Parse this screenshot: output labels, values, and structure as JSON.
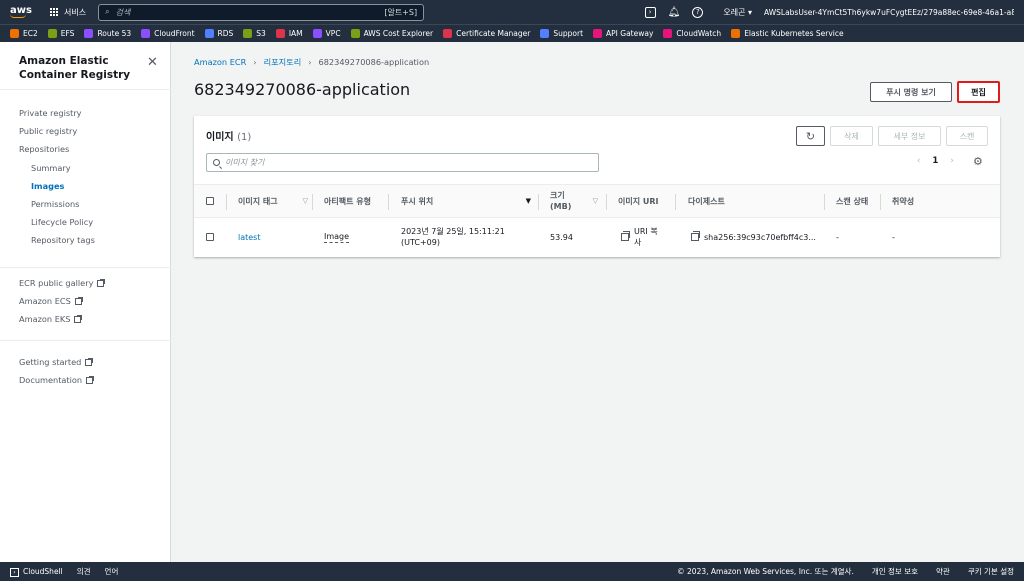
{
  "topbar": {
    "logo": "aws",
    "services_label": "서비스",
    "search_placeholder": "검색",
    "search_shortcut": "[알트+S]",
    "region": "오레곤 ▾",
    "account": "AWSLabsUser-4YmCt5Th6ykw7uFCygtEEz/279a88ec-69e8-46a1-a8f8-fc..."
  },
  "favorites": [
    {
      "label": "EC2",
      "color": "#ed7100"
    },
    {
      "label": "EFS",
      "color": "#7aa116"
    },
    {
      "label": "Route 53",
      "color": "#8c4fff"
    },
    {
      "label": "CloudFront",
      "color": "#8c4fff"
    },
    {
      "label": "RDS",
      "color": "#527fff"
    },
    {
      "label": "S3",
      "color": "#7aa116"
    },
    {
      "label": "IAM",
      "color": "#dd344c"
    },
    {
      "label": "VPC",
      "color": "#8c4fff"
    },
    {
      "label": "AWS Cost Explorer",
      "color": "#7aa116"
    },
    {
      "label": "Certificate Manager",
      "color": "#dd344c"
    },
    {
      "label": "Support",
      "color": "#527fff"
    },
    {
      "label": "API Gateway",
      "color": "#e7157b"
    },
    {
      "label": "CloudWatch",
      "color": "#e7157b"
    },
    {
      "label": "Elastic Kubernetes Service",
      "color": "#ed7100"
    }
  ],
  "sidebar": {
    "title": "Amazon Elastic Container Registry",
    "group1": [
      "Private registry",
      "Public registry",
      "Repositories"
    ],
    "sub": [
      "Summary",
      "Images",
      "Permissions",
      "Lifecycle Policy",
      "Repository tags"
    ],
    "group2": [
      "ECR public gallery",
      "Amazon ECS",
      "Amazon EKS"
    ],
    "group3": [
      "Getting started",
      "Documentation"
    ]
  },
  "breadcrumb": [
    "Amazon ECR",
    "리포지토리",
    "682349270086-application"
  ],
  "page_title": "682349270086-application",
  "buttons": {
    "push_commands": "푸시 명령 보기",
    "edit": "편집"
  },
  "panel": {
    "title": "이미지",
    "count": "(1)",
    "delete": "삭제",
    "details": "세부 정보",
    "scan": "스캔",
    "filter_placeholder": "이미지 찾기",
    "page": "1"
  },
  "table": {
    "headers": {
      "tag": "이미지 태그",
      "artifact": "아티팩트 유형",
      "pushed": "푸시 위치",
      "size": "크기 (MB)",
      "uri": "이미지 URI",
      "digest": "다이제스트",
      "scan_status": "스캔 상태",
      "vuln": "취약성"
    },
    "rows": [
      {
        "tag": "latest",
        "artifact": "Image",
        "pushed": "2023년 7월 25일, 15:11:21 (UTC+09)",
        "size": "53.94",
        "uri": "URI 복사",
        "digest": "sha256:39c93c70efbff4c3...",
        "scan_status": "-",
        "vuln": "-"
      }
    ]
  },
  "footer": {
    "cloudshell": "CloudShell",
    "feedback": "의견",
    "language": "언어",
    "copyright": "© 2023, Amazon Web Services, Inc. 또는 계열사.",
    "privacy": "개인 정보 보호",
    "terms": "약관",
    "cookies": "쿠키 기본 설정"
  }
}
